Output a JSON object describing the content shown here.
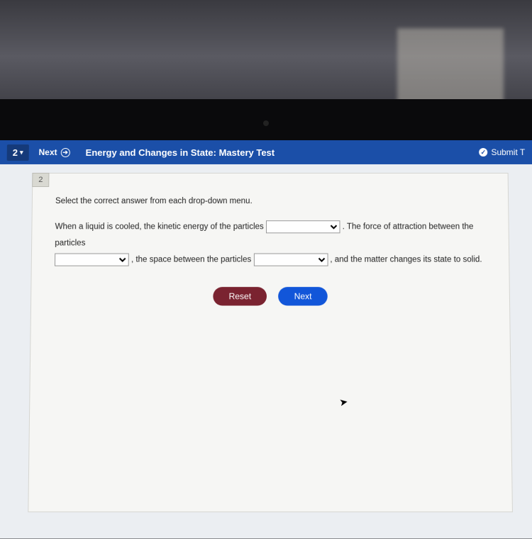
{
  "topbar": {
    "question_indicator": "2",
    "next_nav": "Next",
    "title": "Energy and Changes in State: Mastery Test",
    "submit": "Submit T"
  },
  "question": {
    "number": "2",
    "instruction": "Select the correct answer from each drop-down menu.",
    "seg1": "When a liquid is cooled, the kinetic energy of the particles ",
    "seg2": " . The force of attraction between the particles ",
    "seg3": " , the space between the particles ",
    "seg4": " , and the matter changes its state to solid."
  },
  "buttons": {
    "reset": "Reset",
    "next": "Next"
  }
}
